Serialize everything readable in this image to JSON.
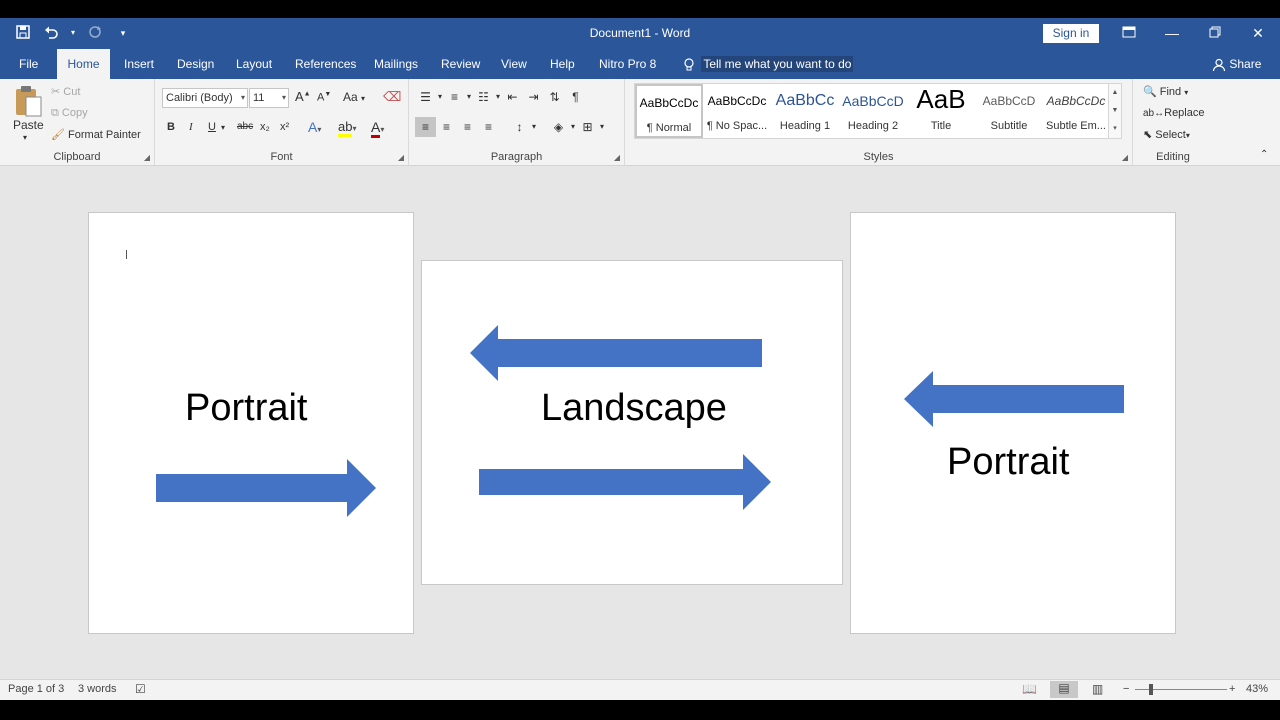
{
  "titlebar": {
    "title": "Document1 - Word",
    "sign_in": "Sign in",
    "qat": [
      {
        "icon": "save-icon",
        "glyph": "💾"
      },
      {
        "icon": "undo-icon",
        "glyph": "↶"
      },
      {
        "icon": "redo-icon",
        "glyph": "↻"
      },
      {
        "icon": "customize-qat-icon",
        "glyph": "▾"
      }
    ]
  },
  "tabs": [
    "File",
    "Home",
    "Insert",
    "Design",
    "Layout",
    "References",
    "Mailings",
    "Review",
    "View",
    "Help",
    "Nitro Pro 8"
  ],
  "active_tab": "Home",
  "tell_me": "Tell me what you want to do",
  "share": "Share",
  "clipboard": {
    "label": "Clipboard",
    "paste": "Paste",
    "cut": "Cut",
    "copy": "Copy",
    "format_painter": "Format Painter"
  },
  "font": {
    "label": "Font",
    "font_name": "Calibri (Body)",
    "font_size": "11",
    "grow": "A",
    "shrink": "A",
    "change_case": "Aa",
    "bold": "B",
    "italic": "I",
    "underline": "U",
    "strike": "abc",
    "subscript": "x₂",
    "superscript": "x²"
  },
  "paragraph": {
    "label": "Paragraph",
    "show_marks": "¶"
  },
  "styles": {
    "label": "Styles",
    "items": [
      {
        "sample": "AaBbCcDc",
        "name": "¶ Normal"
      },
      {
        "sample": "AaBbCcDc",
        "name": "¶ No Spac..."
      },
      {
        "sample": "AaBbCc",
        "name": "Heading 1"
      },
      {
        "sample": "AaBbCcD",
        "name": "Heading 2"
      },
      {
        "sample": "AaB",
        "name": "Title"
      },
      {
        "sample": "AaBbCcD",
        "name": "Subtitle"
      },
      {
        "sample": "AaBbCcDc",
        "name": "Subtle Em..."
      }
    ]
  },
  "editing": {
    "label": "Editing",
    "find": "Find",
    "replace": "Replace",
    "select": "Select"
  },
  "pages": [
    {
      "text": "Portrait",
      "orientation": "portrait"
    },
    {
      "text": "Landscape",
      "orientation": "landscape"
    },
    {
      "text": "Portrait",
      "orientation": "portrait"
    }
  ],
  "colors": {
    "word_blue": "#2b579a",
    "arrow_fill": "#4472c4"
  },
  "status": {
    "page": "Page 1 of 3",
    "words": "3 words",
    "zoom": "43%"
  }
}
